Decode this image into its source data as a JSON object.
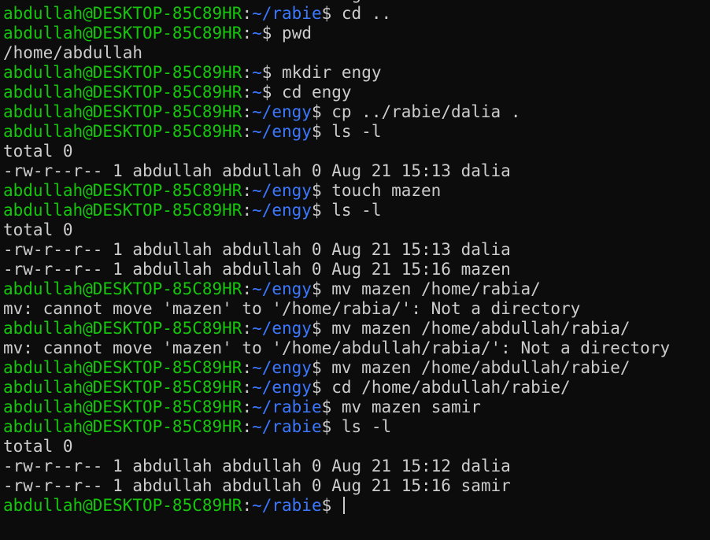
{
  "terminal": {
    "colors": {
      "background": "#0c0c0c",
      "prompt_user": "#16c60c",
      "prompt_path": "#3b78ff",
      "text": "#cccccc"
    },
    "lines": [
      {
        "type": "output",
        "text": "-rw-r--r-- 1 abdullah abdullah 0 Aug 21 15:12 dalia"
      },
      {
        "type": "prompt",
        "user": "abdullah@DESKTOP-85C89HR",
        "path": "~/rabie",
        "cmd": " cd .."
      },
      {
        "type": "prompt",
        "user": "abdullah@DESKTOP-85C89HR",
        "path": "~",
        "cmd": " pwd"
      },
      {
        "type": "output",
        "text": "/home/abdullah"
      },
      {
        "type": "prompt",
        "user": "abdullah@DESKTOP-85C89HR",
        "path": "~",
        "cmd": " mkdir engy"
      },
      {
        "type": "prompt",
        "user": "abdullah@DESKTOP-85C89HR",
        "path": "~",
        "cmd": " cd engy"
      },
      {
        "type": "prompt",
        "user": "abdullah@DESKTOP-85C89HR",
        "path": "~/engy",
        "cmd": " cp ../rabie/dalia ."
      },
      {
        "type": "prompt",
        "user": "abdullah@DESKTOP-85C89HR",
        "path": "~/engy",
        "cmd": " ls -l"
      },
      {
        "type": "output",
        "text": "total 0"
      },
      {
        "type": "output",
        "text": "-rw-r--r-- 1 abdullah abdullah 0 Aug 21 15:13 dalia"
      },
      {
        "type": "prompt",
        "user": "abdullah@DESKTOP-85C89HR",
        "path": "~/engy",
        "cmd": " touch mazen"
      },
      {
        "type": "prompt",
        "user": "abdullah@DESKTOP-85C89HR",
        "path": "~/engy",
        "cmd": " ls -l"
      },
      {
        "type": "output",
        "text": "total 0"
      },
      {
        "type": "output",
        "text": "-rw-r--r-- 1 abdullah abdullah 0 Aug 21 15:13 dalia"
      },
      {
        "type": "output",
        "text": "-rw-r--r-- 1 abdullah abdullah 0 Aug 21 15:16 mazen"
      },
      {
        "type": "prompt",
        "user": "abdullah@DESKTOP-85C89HR",
        "path": "~/engy",
        "cmd": " mv mazen /home/rabia/"
      },
      {
        "type": "output",
        "text": "mv: cannot move 'mazen' to '/home/rabia/': Not a directory"
      },
      {
        "type": "prompt",
        "user": "abdullah@DESKTOP-85C89HR",
        "path": "~/engy",
        "cmd": " mv mazen /home/abdullah/rabia/"
      },
      {
        "type": "output",
        "text": "mv: cannot move 'mazen' to '/home/abdullah/rabia/': Not a directory"
      },
      {
        "type": "prompt",
        "user": "abdullah@DESKTOP-85C89HR",
        "path": "~/engy",
        "cmd": " mv mazen /home/abdullah/rabie/"
      },
      {
        "type": "prompt",
        "user": "abdullah@DESKTOP-85C89HR",
        "path": "~/engy",
        "cmd": " cd /home/abdullah/rabie/"
      },
      {
        "type": "prompt",
        "user": "abdullah@DESKTOP-85C89HR",
        "path": "~/rabie",
        "cmd": " mv mazen samir"
      },
      {
        "type": "prompt",
        "user": "abdullah@DESKTOP-85C89HR",
        "path": "~/rabie",
        "cmd": " ls -l"
      },
      {
        "type": "output",
        "text": "total 0"
      },
      {
        "type": "output",
        "text": "-rw-r--r-- 1 abdullah abdullah 0 Aug 21 15:12 dalia"
      },
      {
        "type": "output",
        "text": "-rw-r--r-- 1 abdullah abdullah 0 Aug 21 15:16 samir"
      },
      {
        "type": "prompt",
        "user": "abdullah@DESKTOP-85C89HR",
        "path": "~/rabie",
        "cmd": " ",
        "cursor": true
      }
    ]
  }
}
